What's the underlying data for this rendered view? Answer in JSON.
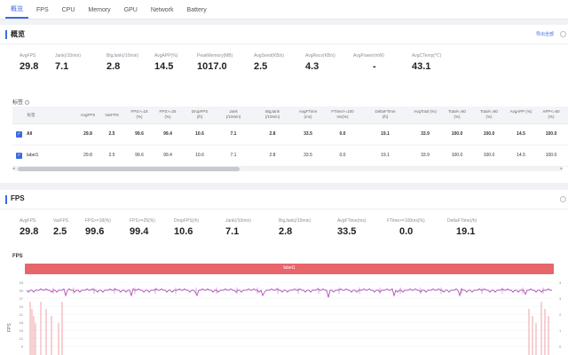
{
  "tabs": [
    {
      "label": "概览",
      "active": true
    },
    {
      "label": "FPS",
      "active": false
    },
    {
      "label": "CPU",
      "active": false
    },
    {
      "label": "Memory",
      "active": false
    },
    {
      "label": "GPU",
      "active": false
    },
    {
      "label": "Network",
      "active": false
    },
    {
      "label": "Battery",
      "active": false
    }
  ],
  "overview": {
    "title": "概览",
    "link": "导出全部",
    "stats": [
      {
        "label": "AvgFPS",
        "value": "29.8"
      },
      {
        "label": "Jank(/10min)",
        "value": "7.1"
      },
      {
        "label": "BigJank(/10min)",
        "value": "2.8"
      },
      {
        "label": "AvgAPP(%)",
        "value": "14.5"
      },
      {
        "label": "PeakMemory(MB)",
        "value": "1017.0"
      },
      {
        "label": "AvgSend(KB/s)",
        "value": "2.5"
      },
      {
        "label": "AvgRecv(KB/s)",
        "value": "4.3"
      },
      {
        "label": "AvgPower(mW)",
        "value": "-"
      },
      {
        "label": "AvgCTemp(℃)",
        "value": "43.1"
      }
    ],
    "detail_label": "标签",
    "table": {
      "headers": [
        "标签",
        "AvgFPS",
        "VarFPS",
        "FPS>=18 (%)",
        "FPS>=25 (%)",
        "DropFPS (/h)",
        "Jank (/10min)",
        "BigJank (/10min)",
        "AvgFTime (ms)",
        "FTime>=100 ms(%)",
        "DeltaFTime (/h)",
        "AvgTotal (%)",
        "Total<=60 (%)",
        "Total<=80 (%)",
        "AvgAPP (%)",
        "APP<=60 (%)"
      ],
      "rows": [
        {
          "name": "All",
          "cells": [
            "29.8",
            "2.5",
            "99.6",
            "99.4",
            "10.6",
            "7.1",
            "2.8",
            "33.5",
            "0.0",
            "19.1",
            "33.9",
            "100.0",
            "100.0",
            "14.5",
            "100.0"
          ]
        },
        {
          "name": "label1",
          "cells": [
            "29.8",
            "2.5",
            "99.6",
            "99.4",
            "10.6",
            "7.1",
            "2.8",
            "33.5",
            "0.0",
            "19.1",
            "33.9",
            "100.0",
            "100.0",
            "14.5",
            "100.0"
          ]
        }
      ]
    }
  },
  "fps": {
    "title": "FPS",
    "stats": [
      {
        "label": "AvgFPS",
        "value": "29.8"
      },
      {
        "label": "VarFPS",
        "value": "2.5"
      },
      {
        "label": "FPS>=18(%)",
        "value": "99.6"
      },
      {
        "label": "FPS>=25(%)",
        "value": "99.4"
      },
      {
        "label": "DropFPS(/h)",
        "value": "10.6"
      },
      {
        "label": "Jank(/10min)",
        "value": "7.1"
      },
      {
        "label": "BigJank(/10min)",
        "value": "2.8"
      },
      {
        "label": "AvgFTime(ms)",
        "value": "33.5"
      },
      {
        "label": "FTime>=100ms(%)",
        "value": "0.0"
      },
      {
        "label": "DeltaFTime(/h)",
        "value": "19.1"
      }
    ],
    "chart_label": "FPS",
    "legend": "label1",
    "y_ticks": [
      "33",
      "30",
      "27",
      "24",
      "21",
      "18",
      "15",
      "12",
      "9"
    ],
    "y_axis": "FPS",
    "right_ticks": [
      "4",
      "3",
      "2",
      "1",
      "0"
    ],
    "colors": {
      "fps_line": "#b04fb8",
      "jank": "#e8656c",
      "legend": "#e8656c",
      "accent": "#3b6be0"
    }
  }
}
